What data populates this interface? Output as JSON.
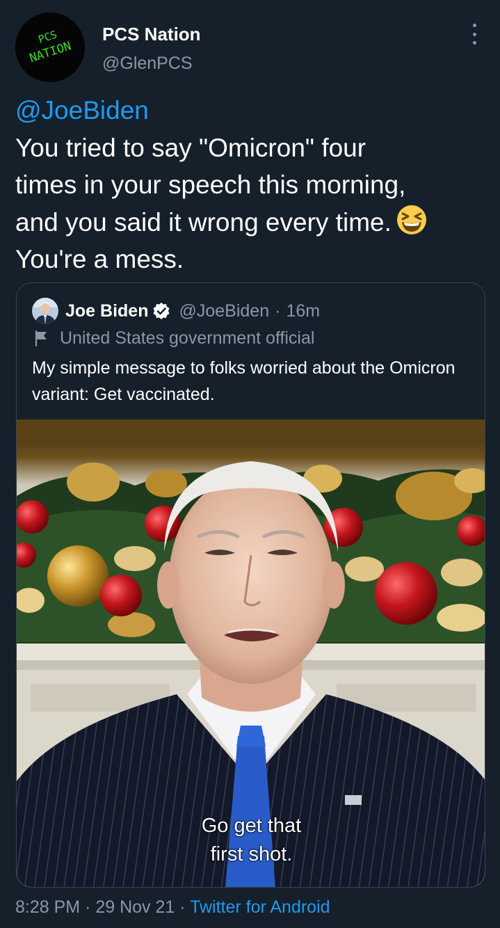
{
  "author": {
    "display_name": "PCS Nation",
    "handle": "@GlenPCS",
    "avatar_text_top": "PCS",
    "avatar_text_bottom": "NATION"
  },
  "tweet": {
    "mention": "@JoeBiden",
    "line1": "You tried to say \"Omicron\" four",
    "line2": "times in your speech this morning,",
    "line3": "and you said it wrong every time.",
    "line4": "You're a mess.",
    "emoji_icon": "grinning-squinting-face-icon"
  },
  "quoted_tweet": {
    "display_name": "Joe Biden",
    "handle": "@JoeBiden",
    "separator": "·",
    "time": "16m",
    "label": "United States government official",
    "text": "My simple message to folks worried about the Omicron variant: Get vaccinated.",
    "video_caption_line1": "Go get that",
    "video_caption_line2": "first shot."
  },
  "footer": {
    "time": "8:28 PM",
    "sep1": " · ",
    "date": "29 Nov 21",
    "sep2": " · ",
    "client": "Twitter for Android"
  },
  "colors": {
    "background": "#15202b",
    "accent": "#1d9bf0",
    "secondary_text": "#8899a6",
    "border": "#38444d"
  }
}
